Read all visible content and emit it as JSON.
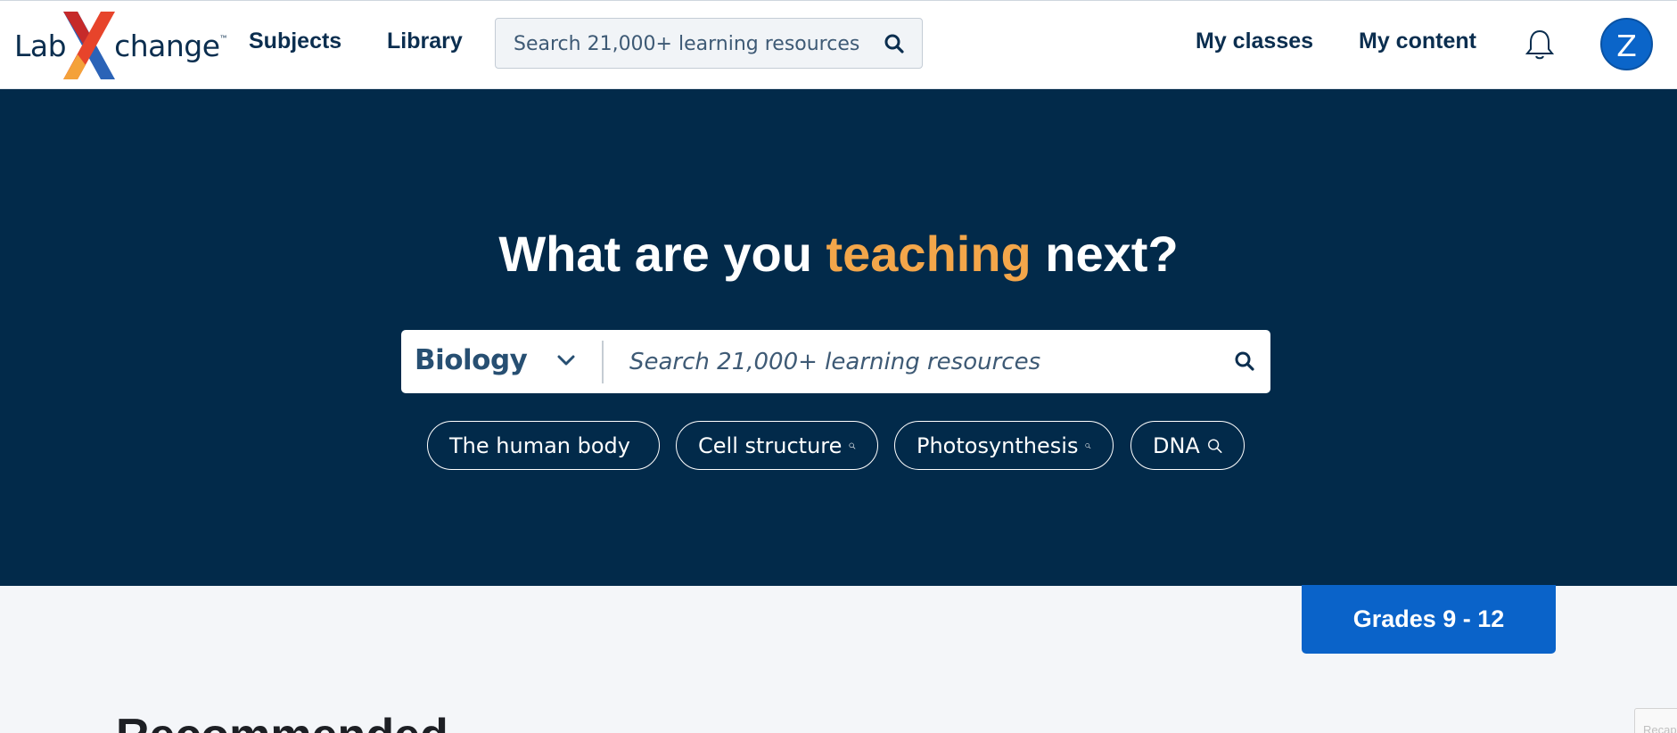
{
  "header": {
    "logo": {
      "part1": "Lab",
      "part2": "change",
      "trademark": "™"
    },
    "nav": {
      "subjects": "Subjects",
      "library": "Library",
      "my_classes": "My classes",
      "my_content": "My content"
    },
    "search": {
      "placeholder": "Search 21,000+ learning resources",
      "icon": "search-icon"
    },
    "notifications_icon": "bell-icon",
    "avatar_initial": "Z"
  },
  "hero": {
    "title_before": "What are you ",
    "title_accent": "teaching",
    "title_after": " next?",
    "subject_select": {
      "value": "Biology"
    },
    "search": {
      "placeholder": "Search 21,000+ learning resources"
    },
    "chips": [
      {
        "label": "The human body"
      },
      {
        "label": "Cell structure"
      },
      {
        "label": "Photosynthesis"
      },
      {
        "label": "DNA"
      }
    ]
  },
  "grade_filter": {
    "label": "Grades 9 - 12"
  },
  "main": {
    "section_title": "Recommended"
  },
  "recaptcha": {
    "label": "Recap"
  },
  "colors": {
    "hero_bg": "#022a4a",
    "accent_orange": "#f3a64a",
    "primary_blue": "#0a63c9",
    "nav_text": "#0b2e4f"
  }
}
